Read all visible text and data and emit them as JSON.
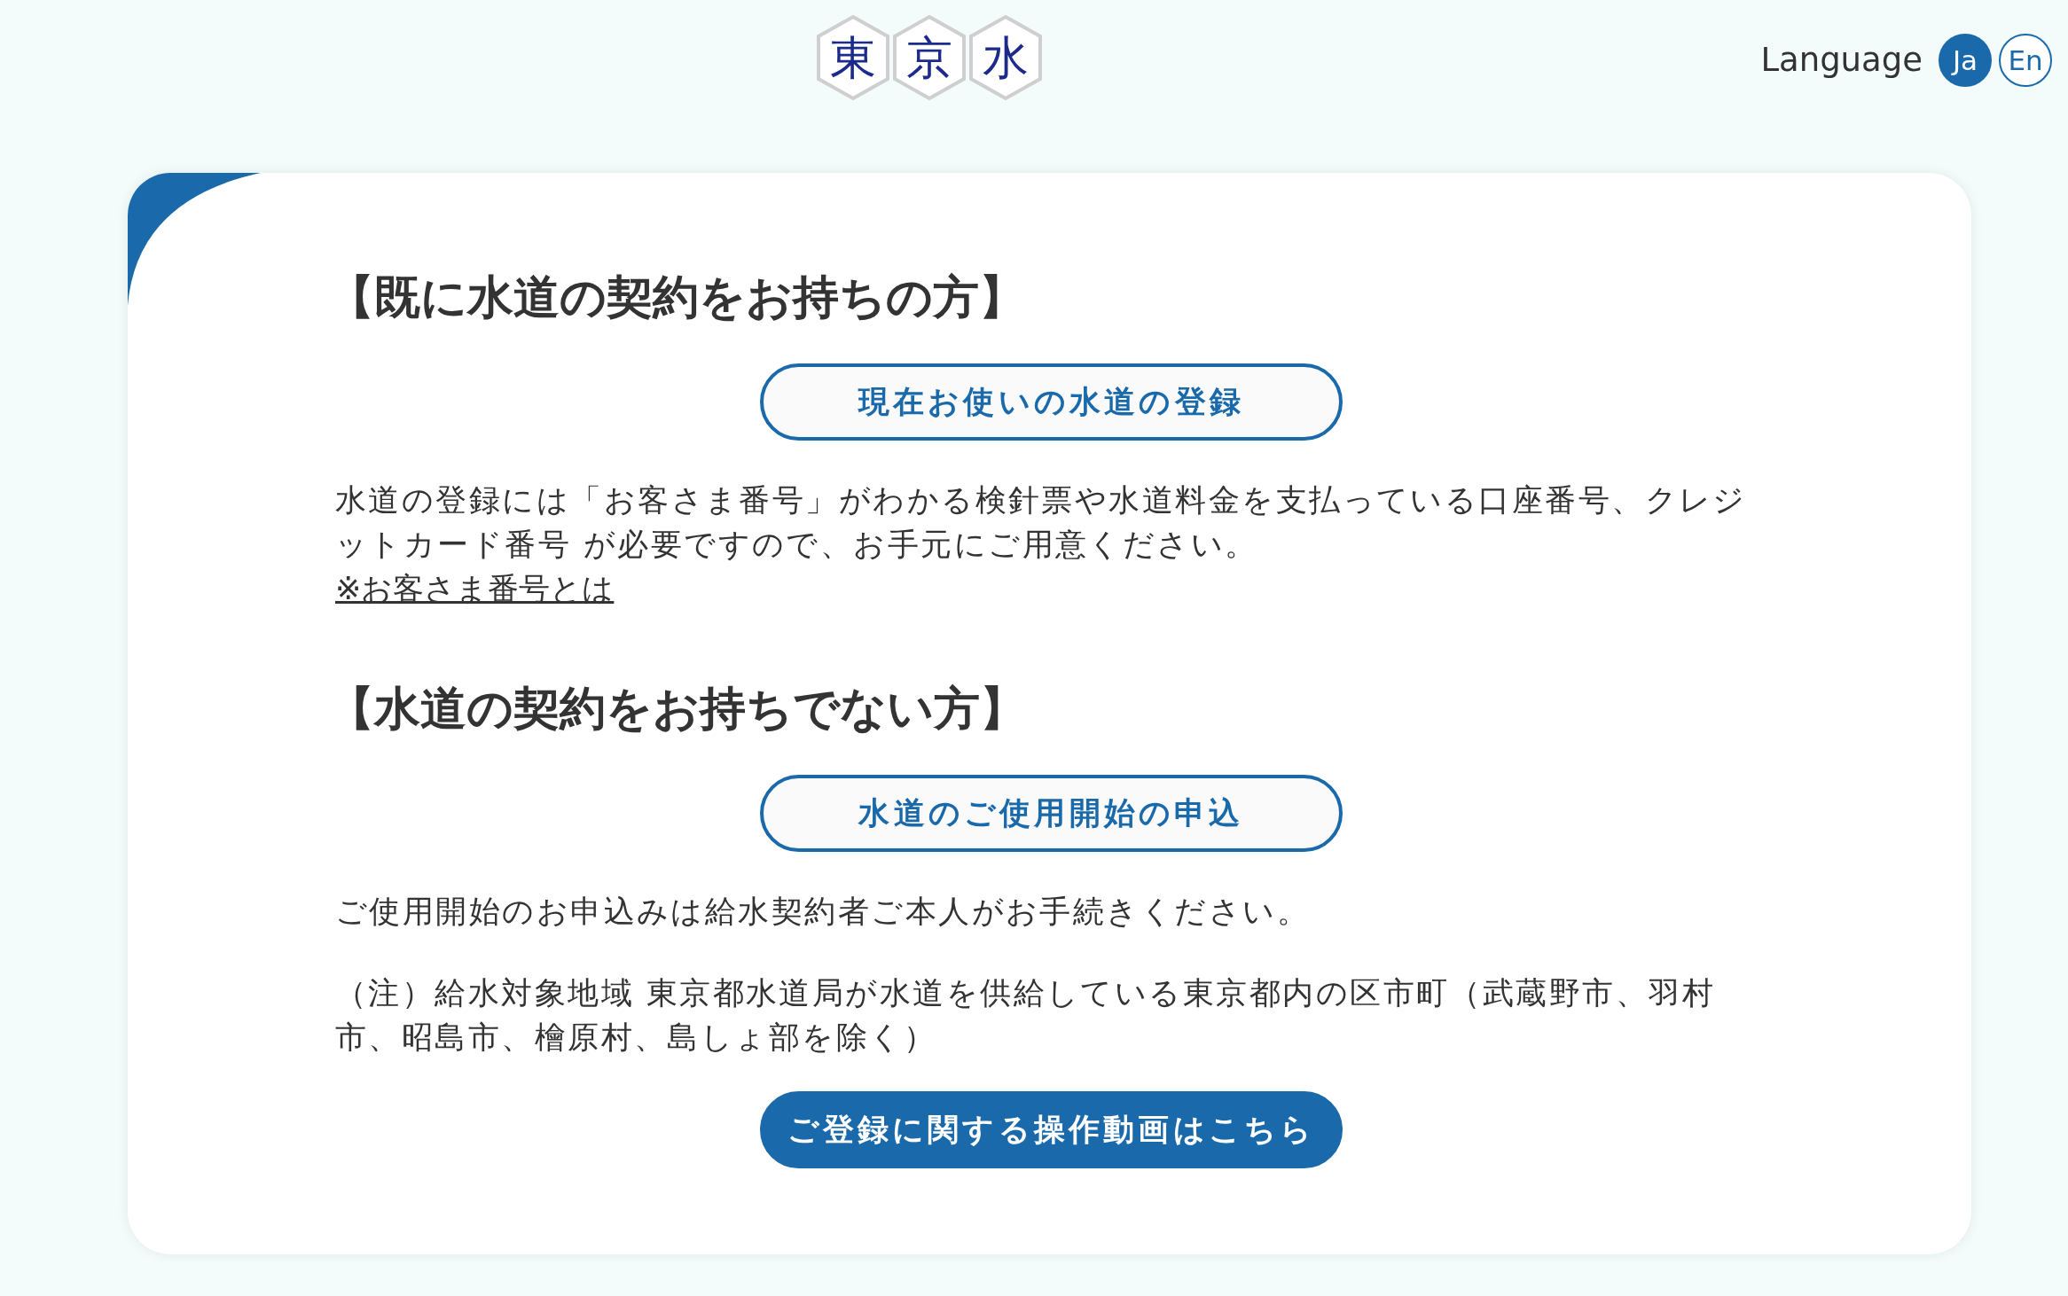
{
  "header": {
    "logo": {
      "characters": [
        "東",
        "京",
        "水"
      ]
    },
    "language": {
      "label": "Language",
      "options": [
        {
          "label": "Ja",
          "selected": true
        },
        {
          "label": "En",
          "selected": false
        }
      ]
    }
  },
  "card": {
    "blocks": [
      {
        "kind": "heading",
        "text": "【既に水道の契約をお持ちの方】"
      },
      {
        "kind": "button",
        "filled": false,
        "text": "現在お使いの水道の登録"
      },
      {
        "kind": "paragraph",
        "text": "水道の登録には「お客さま番号」がわかる検針票や水道料金を支払っている口座番号、クレジットカード番号 が必要ですので、お手元にご用意ください。"
      },
      {
        "kind": "link",
        "text": "※お客さま番号とは"
      },
      {
        "kind": "heading",
        "text": "【水道の契約をお持ちでない方】"
      },
      {
        "kind": "button",
        "filled": false,
        "text": "水道のご使用開始の申込"
      },
      {
        "kind": "paragraph",
        "text": "ご使用開始のお申込みは給水契約者ご本人がお手続きください。"
      },
      {
        "kind": "paragraph",
        "text": "（注）給水対象地域 東京都水道局が水道を供給している東京都内の区市町（武蔵野市、羽村市、昭島市、檜原村、島しょ部を除く）"
      },
      {
        "kind": "button",
        "filled": true,
        "text": "ご登録に関する操作動画はこちら"
      }
    ]
  }
}
